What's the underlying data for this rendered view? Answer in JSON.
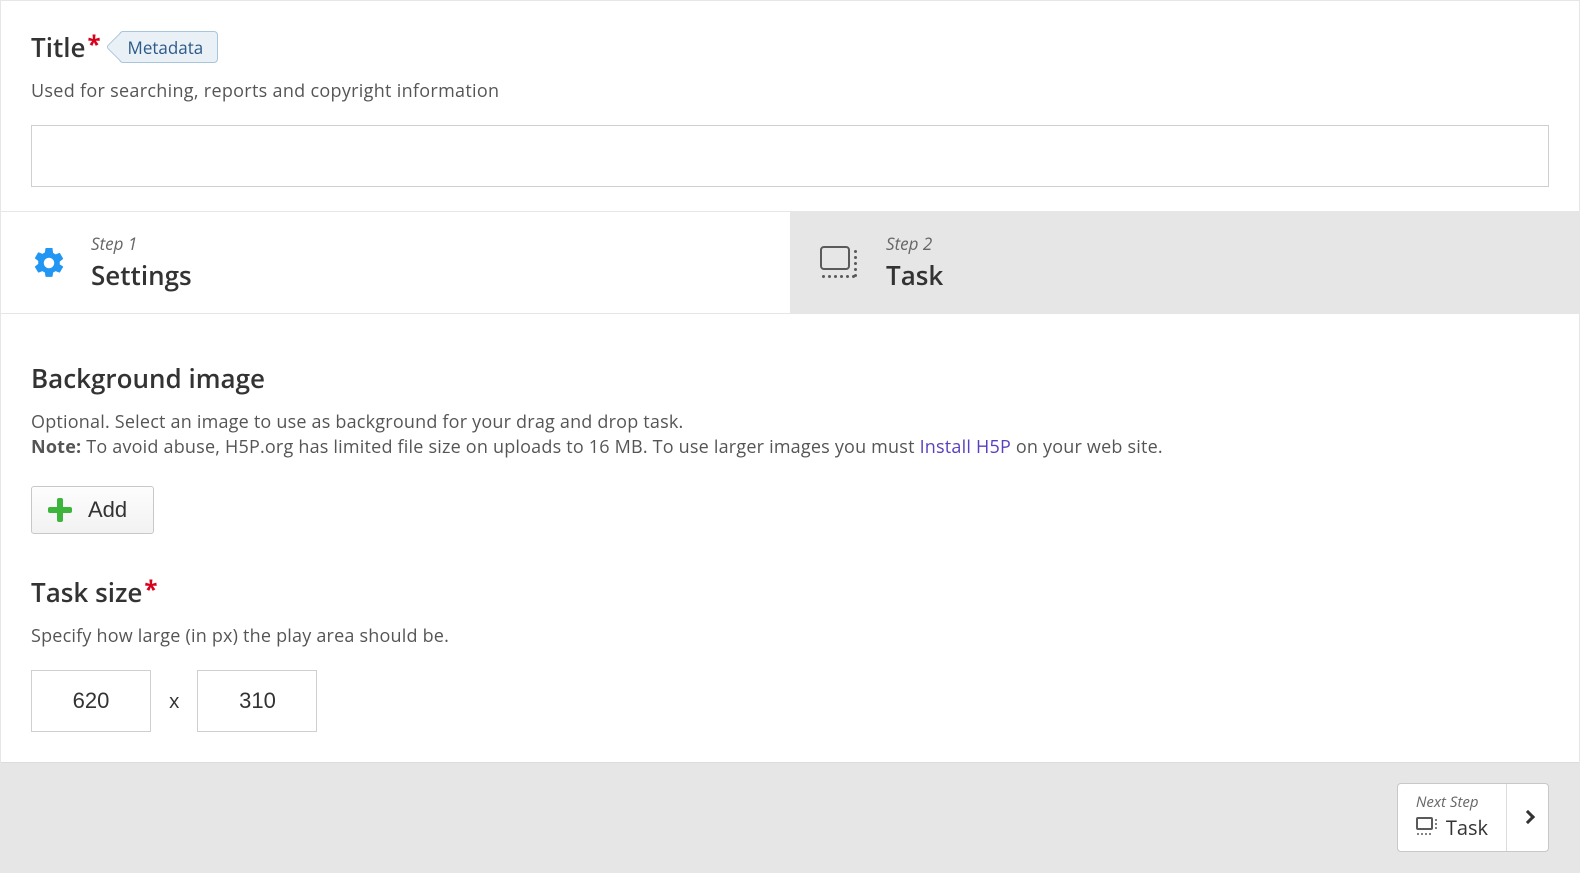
{
  "title": {
    "label": "Title",
    "metadata_tag": "Metadata",
    "description": "Used for searching, reports and copyright information",
    "value": ""
  },
  "steps": {
    "step1": {
      "step_label": "Step 1",
      "name": "Settings"
    },
    "step2": {
      "step_label": "Step 2",
      "name": "Task"
    }
  },
  "background_image": {
    "heading": "Background image",
    "desc_line1": "Optional. Select an image to use as background for your drag and drop task.",
    "note_label": "Note:",
    "note_text_a": " To avoid abuse, H5P.org has limited file size on uploads to 16 MB. To use larger images you must ",
    "note_link": "Install H5P",
    "note_text_b": " on your web site.",
    "add_button": "Add"
  },
  "task_size": {
    "heading": "Task size",
    "description": "Specify how large (in px) the play area should be.",
    "width": "620",
    "height": "310",
    "separator": "x"
  },
  "footer": {
    "next_step_label": "Next Step",
    "next_step_name": "Task"
  },
  "colors": {
    "accent_blue": "#2196f3",
    "required_red": "#d9001b",
    "add_green": "#3db53d",
    "link_purple": "#5a3fc0"
  }
}
